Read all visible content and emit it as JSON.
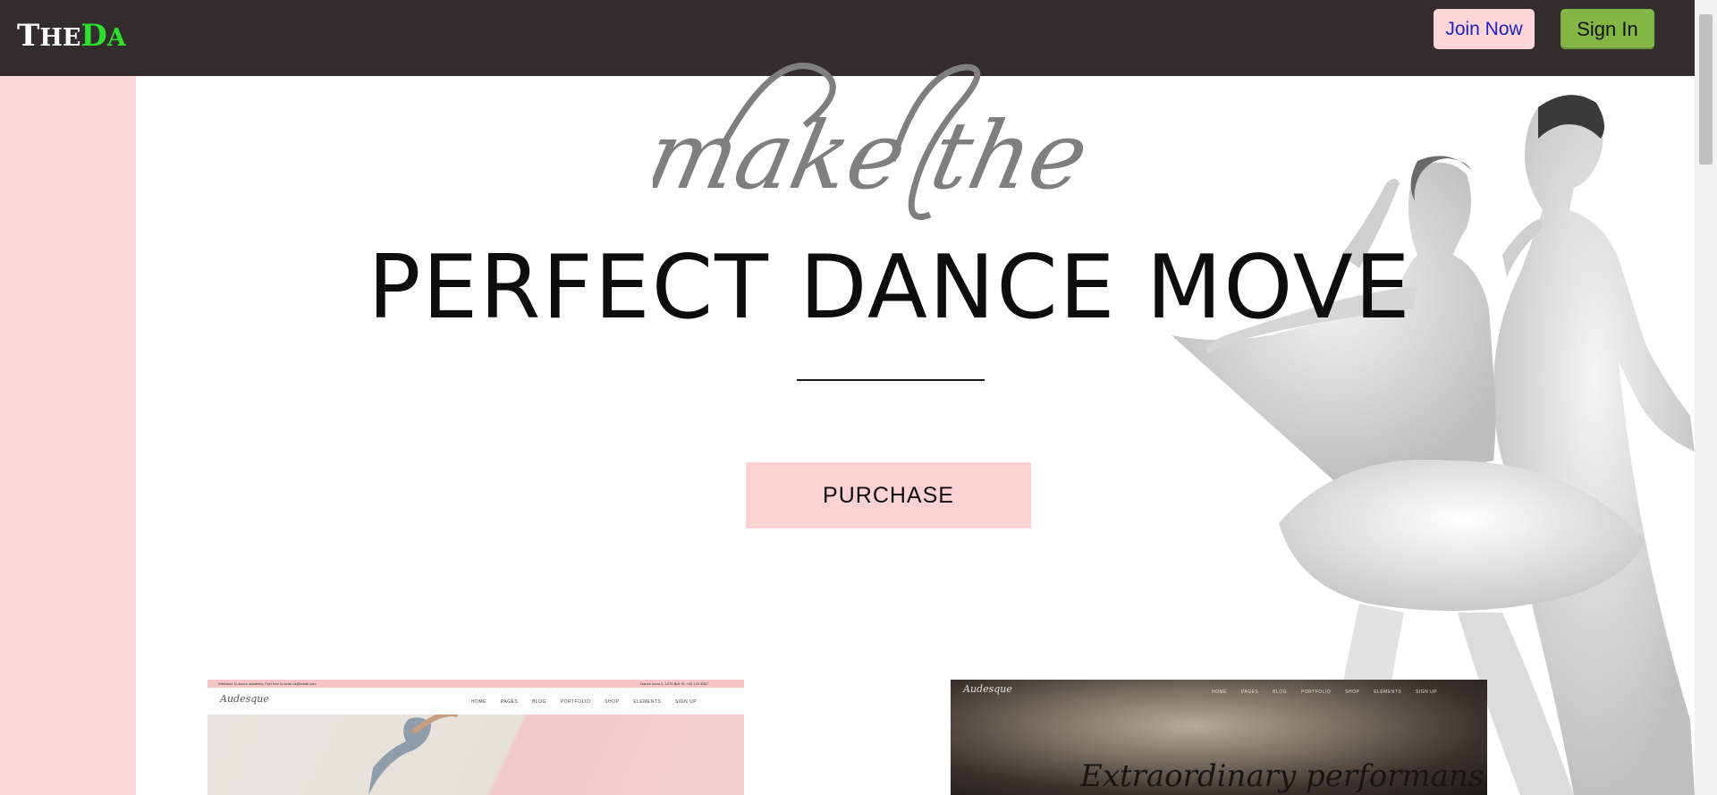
{
  "header": {
    "logo": {
      "part1": "T",
      "part2": "HE",
      "part3": "D",
      "part4": "A"
    },
    "join_label": "Join Now",
    "signin_label": "Sign In"
  },
  "hero": {
    "script_text": "make the",
    "headline": "PERFECT DANCE MOVE",
    "cta_label": "PURCHASE"
  },
  "previews": [
    {
      "topbar_left": "Welcome to dance academy. Feel free to write us@email.com",
      "topbar_right": "Dance room 2, 1075 Bull St, +00 123 4567",
      "logo": "Audesque",
      "menu": [
        "HOME",
        "PAGES",
        "BLOG",
        "PORTFOLIO",
        "SHOP",
        "ELEMENTS",
        "SIGN UP"
      ]
    },
    {
      "logo": "Audesque",
      "menu": [
        "HOME",
        "PAGES",
        "BLOG",
        "PORTFOLIO",
        "SHOP",
        "ELEMENTS",
        "SIGN UP"
      ],
      "title": "Extraordinary performans"
    }
  ],
  "colors": {
    "header_bg": "#332d2e",
    "accent_pink": "#fdd2d2",
    "signin_green": "#83b745",
    "logo_green": "#2ee02e"
  }
}
